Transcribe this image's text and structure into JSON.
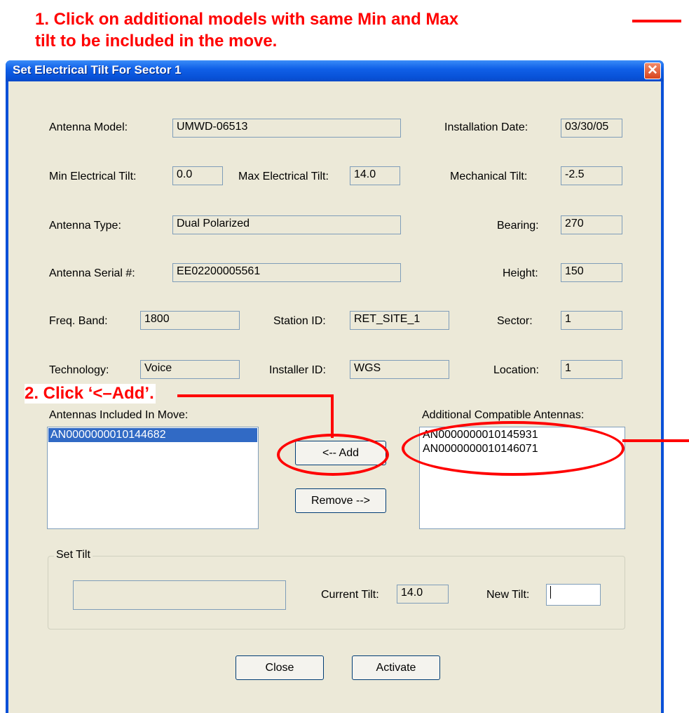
{
  "annotations": {
    "step1": "1. Click on additional models with same Min and Max\ntilt to be included in the move.",
    "step2": "2. Click ‘<–Add’."
  },
  "dialog": {
    "title": "Set Electrical Tilt For Sector 1",
    "close_glyph": "✕"
  },
  "fields": {
    "antenna_model": {
      "label": "Antenna Model:",
      "value": "UMWD-06513"
    },
    "installation_date": {
      "label": "Installation Date:",
      "value": "03/30/05"
    },
    "min_tilt": {
      "label": "Min Electrical Tilt:",
      "value": "0.0"
    },
    "max_tilt": {
      "label": "Max Electrical Tilt:",
      "value": "14.0"
    },
    "mechanical_tilt": {
      "label": "Mechanical Tilt:",
      "value": "-2.5"
    },
    "antenna_type": {
      "label": "Antenna Type:",
      "value": "Dual Polarized"
    },
    "bearing": {
      "label": "Bearing:",
      "value": "270"
    },
    "serial": {
      "label": "Antenna Serial #:",
      "value": "EE02200005561"
    },
    "height": {
      "label": "Height:",
      "value": "150"
    },
    "freq_band": {
      "label": "Freq. Band:",
      "value": "1800"
    },
    "station_id": {
      "label": "Station ID:",
      "value": "RET_SITE_1"
    },
    "sector": {
      "label": "Sector:",
      "value": "1"
    },
    "technology": {
      "label": "Technology:",
      "value": "Voice"
    },
    "installer_id": {
      "label": "Installer ID:",
      "value": "WGS"
    },
    "location": {
      "label": "Location:",
      "value": "1"
    }
  },
  "included": {
    "label": "Antennas Included In Move:",
    "items": [
      "AN0000000010144682"
    ]
  },
  "compatible": {
    "label": "Additional Compatible Antennas:",
    "items": [
      "AN0000000010145931",
      "AN0000000010146071"
    ]
  },
  "buttons": {
    "add": "<-- Add",
    "remove": "Remove -->",
    "close": "Close",
    "activate": "Activate"
  },
  "set_tilt": {
    "title": "Set Tilt",
    "current_label": "Current Tilt:",
    "current_value": "14.0",
    "new_label": "New Tilt:",
    "new_value": ""
  },
  "colors": {
    "annotation": "#ff0000",
    "title_bar": "#0a50d8",
    "dialog_face": "#ece9d8",
    "selection": "#316ac5"
  }
}
